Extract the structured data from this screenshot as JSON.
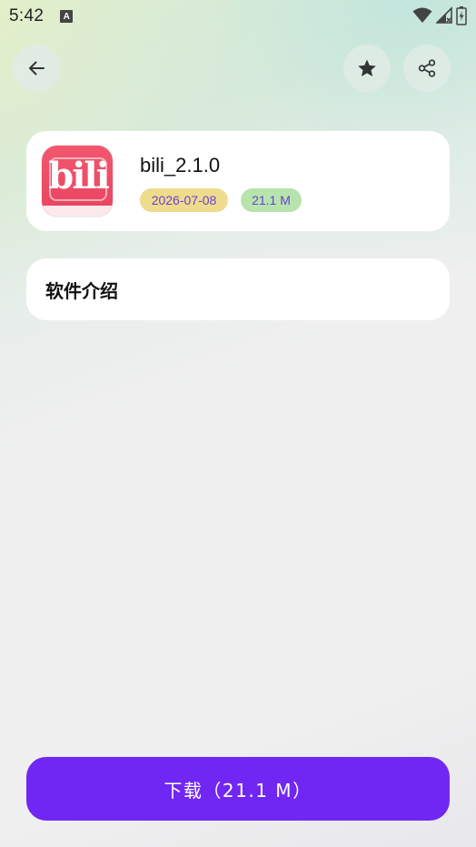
{
  "status_bar": {
    "time": "5:42",
    "notification_icon": "A"
  },
  "header": {
    "back_icon": "arrow-left-icon",
    "favorite_icon": "star-icon",
    "share_icon": "share-icon"
  },
  "app": {
    "icon_text": "bili",
    "name": "bili_2.1.0",
    "date": "2026-07-08",
    "size": "21.1 M"
  },
  "intro": {
    "title": "软件介绍"
  },
  "download": {
    "label": "下载（21.1 M）"
  },
  "colors": {
    "accent": "#7127f3",
    "date_tag_bg": "#eedc8c",
    "size_tag_bg": "#b7e4ad",
    "tag_text": "#6a3fd0"
  }
}
